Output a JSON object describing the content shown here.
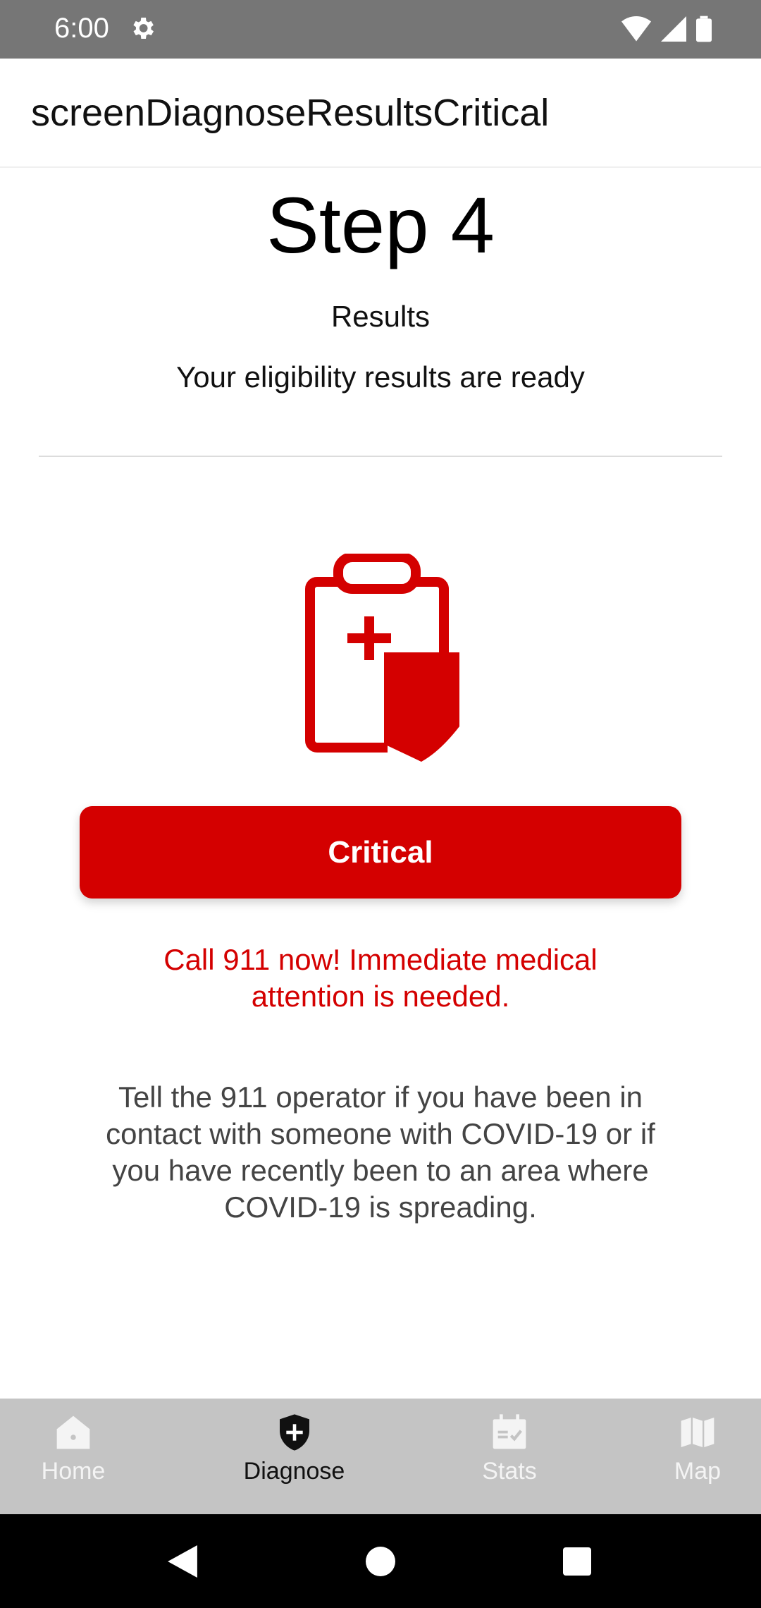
{
  "status_bar": {
    "time": "6:00"
  },
  "app_bar": {
    "title": "screenDiagnoseResultsCritical"
  },
  "main": {
    "step_title": "Step 4",
    "subtitle": "Results",
    "description": "Your eligibility results are ready",
    "status_label": "Critical",
    "alert": "Call 911 now! Immediate medical attention is needed.",
    "info": "Tell the 911 operator if you have been in contact with someone with COVID-19 or if you have recently been to an area where COVID-19 is spreading."
  },
  "bottom_nav": {
    "items": [
      {
        "label": "Home",
        "icon": "home-icon",
        "active": false
      },
      {
        "label": "Diagnose",
        "icon": "shield-plus-icon",
        "active": true
      },
      {
        "label": "Stats",
        "icon": "calendar-check-icon",
        "active": false
      },
      {
        "label": "Map",
        "icon": "map-icon",
        "active": false
      }
    ]
  },
  "colors": {
    "critical": "#d40000",
    "status_bar": "#767676",
    "nav_bg": "#c4c4c4"
  }
}
